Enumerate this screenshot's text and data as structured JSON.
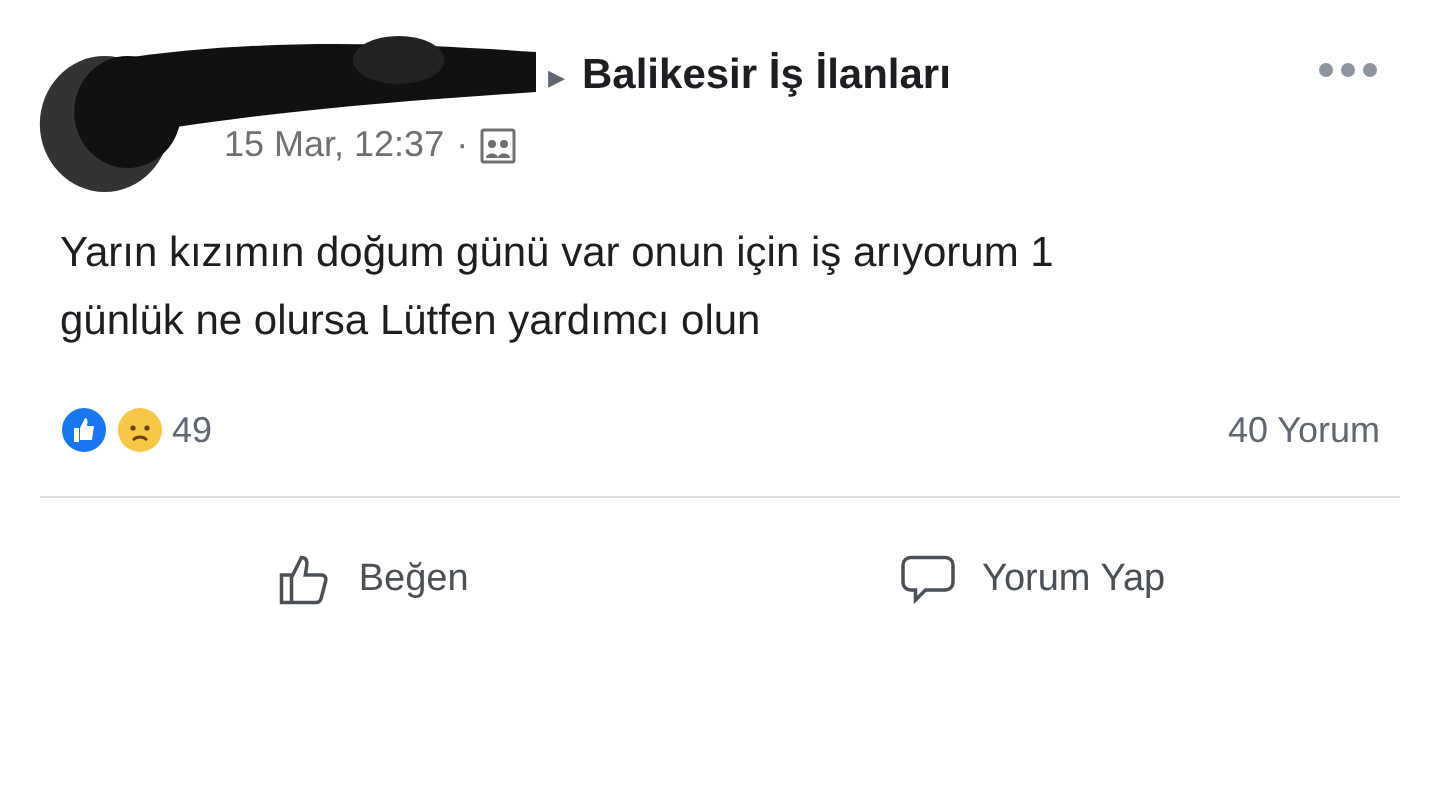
{
  "post": {
    "group": "Balikesir İş İlanları",
    "separator": "▸",
    "time": "15 Mar, 12:37",
    "dot": "·",
    "text": "Yarın kızımın doğum günü var onun için iş arıyorum 1 günlük ne olursa Lütfen yardımcı olun"
  },
  "reactions": {
    "count": "49",
    "comments": "40 Yorum"
  },
  "actions": [
    {
      "kind": "like",
      "label": "Beğen"
    },
    {
      "kind": "comment",
      "label": "Yorum Yap"
    }
  ]
}
